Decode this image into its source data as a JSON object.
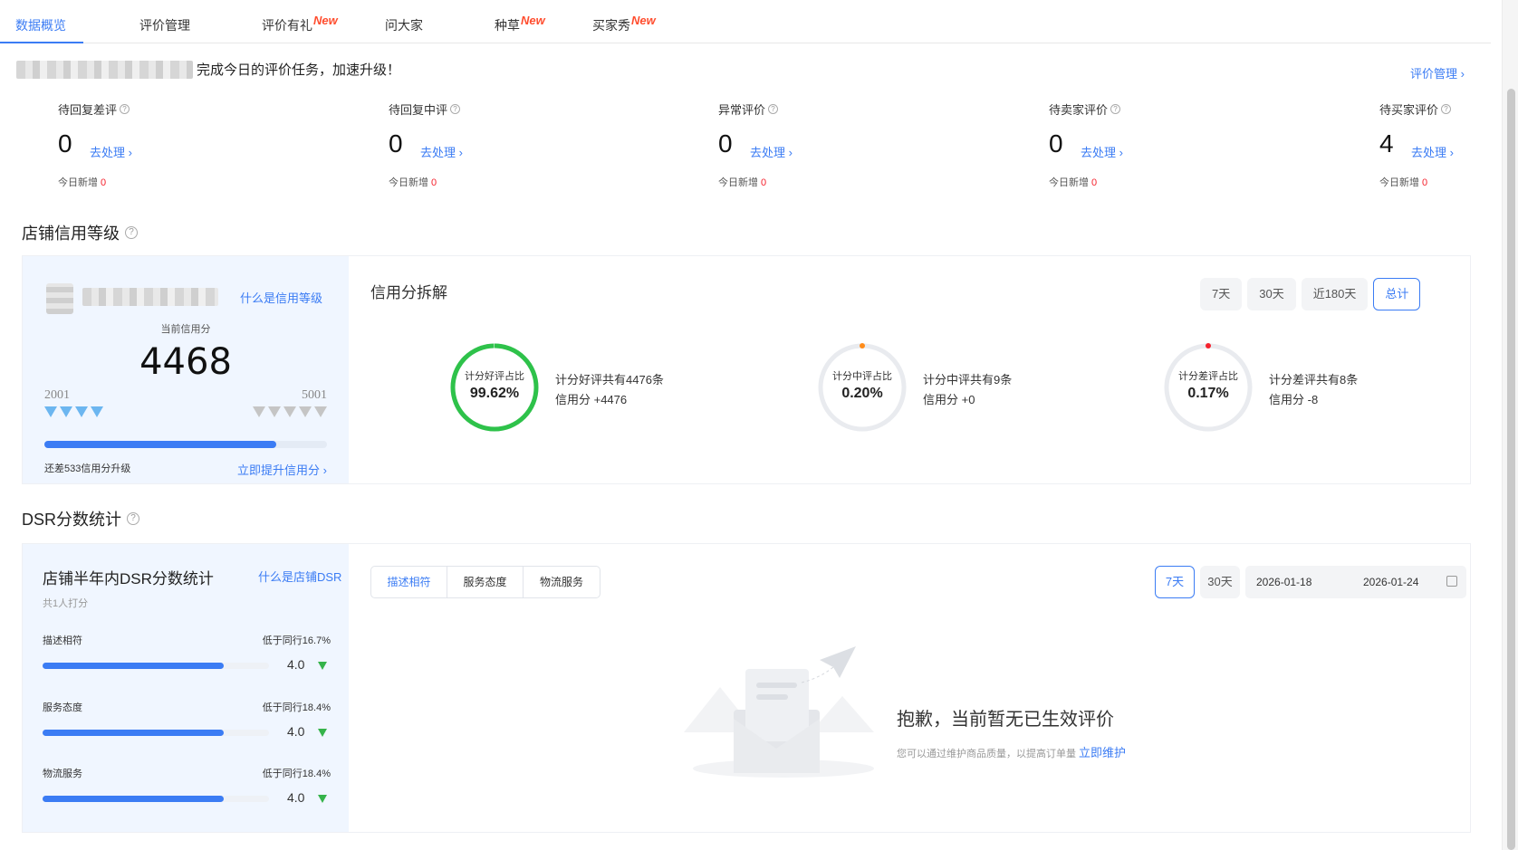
{
  "tabs": [
    {
      "label": "数据概览",
      "new": ""
    },
    {
      "label": "评价管理",
      "new": ""
    },
    {
      "label": "评价有礼",
      "new": "New"
    },
    {
      "label": "问大家",
      "new": ""
    },
    {
      "label": "种草",
      "new": "New"
    },
    {
      "label": "买家秀",
      "new": "New"
    }
  ],
  "banner": {
    "text": "完成今日的评价任务，加速升级！",
    "review_mgmt": "评价管理 ›"
  },
  "stats": [
    {
      "label": "待回复差评",
      "value": "0",
      "go": "去处理 ›",
      "today_label": "今日新增",
      "today": "0"
    },
    {
      "label": "待回复中评",
      "value": "0",
      "go": "去处理 ›",
      "today_label": "今日新增",
      "today": "0"
    },
    {
      "label": "异常评价",
      "value": "0",
      "go": "去处理 ›",
      "today_label": "今日新增",
      "today": "0"
    },
    {
      "label": "待卖家评价",
      "value": "0",
      "go": "去处理 ›",
      "today_label": "今日新增",
      "today": "0"
    },
    {
      "label": "待买家评价",
      "value": "4",
      "go": "去处理 ›",
      "today_label": "今日新增",
      "today": "0"
    }
  ],
  "credit": {
    "section_title": "店铺信用等级",
    "what_link": "什么是信用等级",
    "current_label": "当前信用分",
    "score": "4468",
    "level_min": "2001",
    "level_max": "5001",
    "progress_fraction": 0.82,
    "remain_text": "还差533信用分升级",
    "raise_link": "立即提升信用分 ›",
    "breakdown_title": "信用分拆解",
    "ranges": [
      "7天",
      "30天",
      "近180天",
      "总计"
    ],
    "active_range": "总计",
    "rings": [
      {
        "label": "计分好评占比",
        "value": "99.62%",
        "fraction": 0.9962,
        "color": "#2ec24a",
        "desc1": "计分好评共有4476条",
        "desc2": "信用分 +4476"
      },
      {
        "label": "计分中评占比",
        "value": "0.20%",
        "fraction": 0.002,
        "color": "#ff8c1a",
        "desc1": "计分中评共有9条",
        "desc2": "信用分 +0"
      },
      {
        "label": "计分差评占比",
        "value": "0.17%",
        "fraction": 0.0017,
        "color": "#f5222d",
        "desc1": "计分差评共有8条",
        "desc2": "信用分 -8"
      }
    ]
  },
  "dsr": {
    "section_title": "DSR分数统计",
    "panel_title": "店铺半年内DSR分数统计",
    "what_link": "什么是店铺DSR",
    "raters": "共1人打分",
    "rows": [
      {
        "name": "描述相符",
        "compare": "低于同行16.7%",
        "value": "4.0",
        "fraction": 0.8
      },
      {
        "name": "服务态度",
        "compare": "低于同行18.4%",
        "value": "4.0",
        "fraction": 0.8
      },
      {
        "name": "物流服务",
        "compare": "低于同行18.4%",
        "value": "4.0",
        "fraction": 0.8
      }
    ],
    "segments": [
      "描述相符",
      "服务态度",
      "物流服务"
    ],
    "active_segment": "描述相符",
    "ranges": [
      "7天",
      "30天"
    ],
    "active_range": "7天",
    "date_start": "2026-01-18",
    "date_end": "2026-01-24",
    "empty_title": "抱歉，当前暂无已生效评价",
    "empty_sub": "您可以通过维护商品质量，以提高订单量",
    "empty_link": "立即维护"
  },
  "icons": {
    "help": "question-circle-icon",
    "calendar": "calendar-icon",
    "diamond": "diamond-icon",
    "down_arrow": "down-triangle-icon"
  },
  "colors": {
    "accent": "#3b7cf4",
    "new_badge": "#ff4d2e",
    "panel_bg": "#f0f6ff",
    "down": "#35b34a"
  }
}
